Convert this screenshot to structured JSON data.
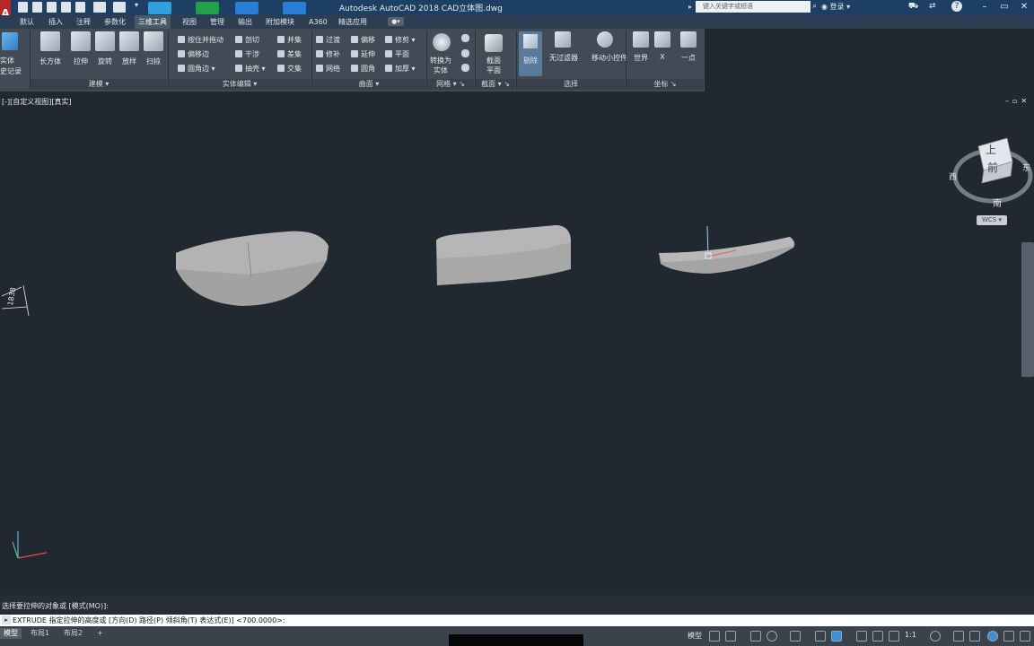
{
  "app": {
    "logo_letter": "A",
    "window_title": "Autodesk AutoCAD 2018    CAD立体图.dwg",
    "search_placeholder": "键入关键字或短语",
    "login_label": "登录",
    "window_controls": [
      "–",
      "▭",
      "✕"
    ]
  },
  "ribbon_tabs": [
    {
      "label": "默认",
      "active": false
    },
    {
      "label": "插入",
      "active": false
    },
    {
      "label": "注释",
      "active": false
    },
    {
      "label": "参数化",
      "active": false
    },
    {
      "label": "三维工具",
      "active": true
    },
    {
      "label": "视图",
      "active": false
    },
    {
      "label": "管理",
      "active": false
    },
    {
      "label": "输出",
      "active": false
    },
    {
      "label": "附加模块",
      "active": false
    },
    {
      "label": "A360",
      "active": false
    },
    {
      "label": "精选应用",
      "active": false
    }
  ],
  "ribbon": {
    "left_partial": [
      "实体",
      "史记录"
    ],
    "modeling": {
      "title": "建模",
      "buttons": [
        "长方体",
        "拉伸",
        "旋转",
        "放样",
        "扫掠"
      ]
    },
    "solid_edit": {
      "title": "实体编辑",
      "col1": [
        "按住并拖动",
        "偏移边",
        "圆角边"
      ],
      "col2": [
        "剖切",
        "干涉",
        "抽壳"
      ],
      "col3": [
        "并集",
        "差集",
        "交集"
      ]
    },
    "surface": {
      "title": "曲面",
      "col1": [
        "过渡",
        "修补",
        "网络"
      ],
      "col2": [
        "偏移",
        "延伸",
        "圆角"
      ],
      "col3": [
        "修剪",
        "平面",
        "加厚"
      ]
    },
    "mesh": {
      "title": "网格",
      "label_line1": "转换为",
      "label_line2": "实体"
    },
    "section": {
      "title": "截面",
      "label_line1": "截面",
      "label_line2": "平面"
    },
    "selection": {
      "title": "选择",
      "buttons": [
        "无过滤器",
        "移动小控件"
      ],
      "toggle": "剔除"
    },
    "coordinates": {
      "title": "坐标",
      "buttons": [
        "世界",
        "X",
        "一点"
      ]
    }
  },
  "viewport": {
    "label": "[-][自定义视图][真实]",
    "viewcube": {
      "top": "上",
      "front": "前",
      "west": "西",
      "east": "东",
      "south": "南",
      "wcs": "WCS"
    },
    "side_dim": "1838"
  },
  "command": {
    "history": "选择要拉伸的对象或 [模式(MO)]:",
    "prompt": "EXTRUDE 指定拉伸的高度或 [方向(D) 路径(P) 倾斜角(T) 表达式(E)] <700.0000>:"
  },
  "status": {
    "layout_tabs": [
      {
        "label": "模型",
        "active": true
      },
      {
        "label": "布局1",
        "active": false
      },
      {
        "label": "布局2",
        "active": false
      }
    ],
    "add_tab": "+",
    "model_label": "模型",
    "scale": "1:1"
  },
  "colors": {
    "titlebar": "#1c3f63",
    "ribbon": "#414b56",
    "viewport": "#212830",
    "solid_fill": "#a6a6a6",
    "app_red": "#b8252a"
  }
}
